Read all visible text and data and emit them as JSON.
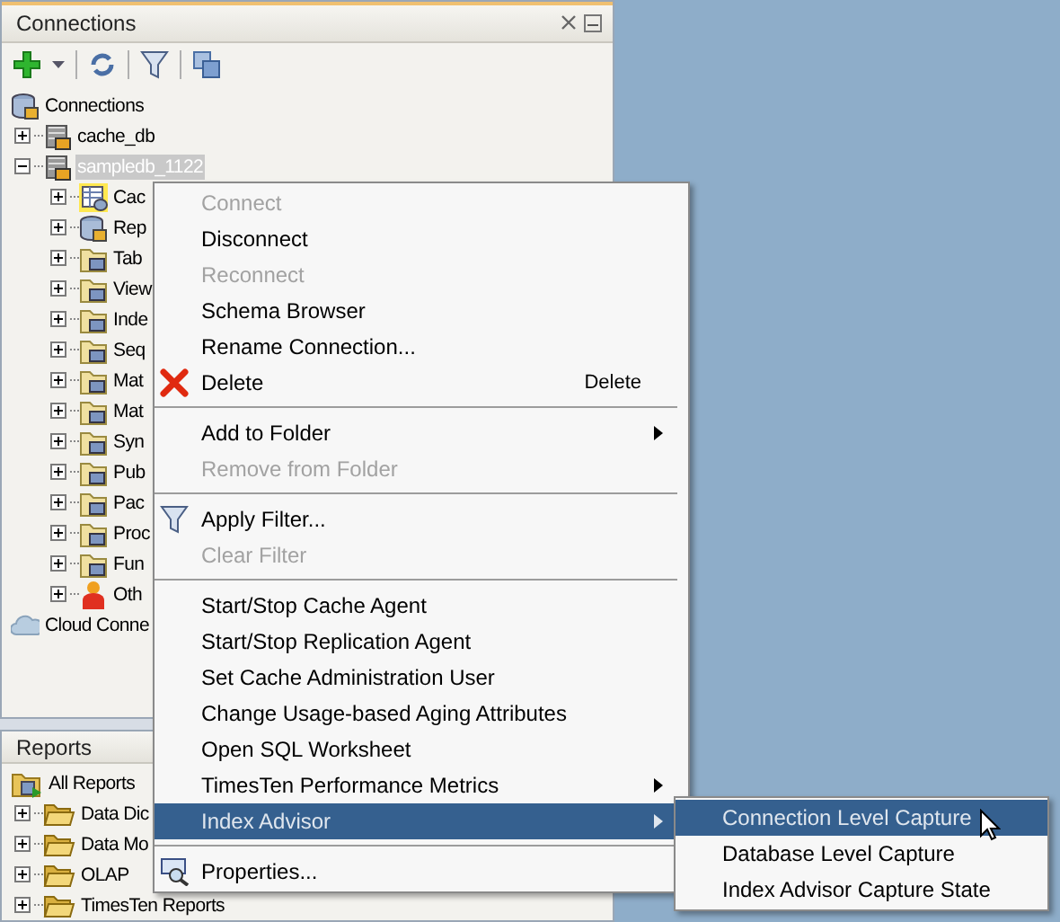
{
  "connections_panel": {
    "title": "Connections",
    "tree": [
      {
        "label": "Connections",
        "kind": "database",
        "children": [
          {
            "label": "cache_db",
            "kind": "connection",
            "expanded": false,
            "selected": false
          },
          {
            "label": "sampledb_1122",
            "kind": "connection",
            "expanded": true,
            "selected": true,
            "children": [
              {
                "label": "Cac",
                "kind": "table",
                "expanded": false
              },
              {
                "label": "Rep",
                "kind": "database",
                "expanded": false
              },
              {
                "label": "Tab",
                "kind": "folder",
                "expanded": false
              },
              {
                "label": "View",
                "kind": "folder",
                "expanded": false
              },
              {
                "label": "Inde",
                "kind": "folder",
                "expanded": false
              },
              {
                "label": "Seq",
                "kind": "folder",
                "expanded": false
              },
              {
                "label": "Mat",
                "kind": "folder",
                "expanded": false
              },
              {
                "label": "Mat",
                "kind": "folder",
                "expanded": false
              },
              {
                "label": "Syn",
                "kind": "folder",
                "expanded": false
              },
              {
                "label": "Pub",
                "kind": "folder",
                "expanded": false
              },
              {
                "label": "Pac",
                "kind": "folder",
                "expanded": false
              },
              {
                "label": "Proc",
                "kind": "folder",
                "expanded": false
              },
              {
                "label": "Fun",
                "kind": "folder",
                "expanded": false
              },
              {
                "label": "Oth",
                "kind": "person",
                "expanded": false
              }
            ]
          }
        ]
      },
      {
        "label": "Cloud Conne",
        "kind": "cloud"
      }
    ]
  },
  "reports_panel": {
    "title": "Reports",
    "tree": [
      {
        "label": "All Reports",
        "kind": "reports",
        "children": [
          {
            "label": "Data Dic",
            "kind": "open-folder",
            "expanded": false
          },
          {
            "label": "Data Mo",
            "kind": "open-folder",
            "expanded": false
          },
          {
            "label": "OLAP",
            "kind": "open-folder",
            "expanded": false
          },
          {
            "label": "TimesTen Reports",
            "kind": "open-folder",
            "expanded": false
          }
        ]
      }
    ]
  },
  "context_menu": [
    {
      "kind": "item",
      "label": "Connect",
      "disabled": true,
      "selected": false
    },
    {
      "kind": "item",
      "label": "Disconnect",
      "disabled": false,
      "selected": false
    },
    {
      "kind": "item",
      "label": "Reconnect",
      "disabled": true,
      "selected": false
    },
    {
      "kind": "item",
      "label": "Schema Browser",
      "disabled": false,
      "selected": false
    },
    {
      "kind": "item",
      "label": "Rename Connection...",
      "disabled": false,
      "selected": false
    },
    {
      "kind": "delete",
      "label": "Delete",
      "shortcut": "Delete",
      "disabled": false,
      "selected": false
    },
    {
      "kind": "separator"
    },
    {
      "kind": "item",
      "label": "Add to Folder",
      "submenu": true,
      "disabled": false,
      "selected": false
    },
    {
      "kind": "item",
      "label": "Remove from Folder",
      "disabled": true,
      "selected": false
    },
    {
      "kind": "separator"
    },
    {
      "kind": "filter",
      "label": "Apply Filter...",
      "disabled": false,
      "selected": false
    },
    {
      "kind": "item",
      "label": "Clear Filter",
      "disabled": true,
      "selected": false
    },
    {
      "kind": "separator"
    },
    {
      "kind": "item",
      "label": "Start/Stop Cache Agent",
      "disabled": false,
      "selected": false
    },
    {
      "kind": "item",
      "label": "Start/Stop Replication Agent",
      "disabled": false,
      "selected": false
    },
    {
      "kind": "item",
      "label": "Set Cache Administration User",
      "disabled": false,
      "selected": false
    },
    {
      "kind": "item",
      "label": "Change Usage-based Aging Attributes",
      "disabled": false,
      "selected": false
    },
    {
      "kind": "item",
      "label": "Open SQL Worksheet",
      "disabled": false,
      "selected": false
    },
    {
      "kind": "item",
      "label": "TimesTen Performance Metrics",
      "submenu": true,
      "disabled": false,
      "selected": false
    },
    {
      "kind": "item",
      "label": "Index Advisor",
      "submenu": true,
      "disabled": false,
      "selected": true
    },
    {
      "kind": "separator"
    },
    {
      "kind": "properties",
      "label": "Properties...",
      "disabled": false,
      "selected": false
    }
  ],
  "submenu": [
    {
      "label": "Connection Level Capture",
      "selected": true
    },
    {
      "label": "Database Level Capture",
      "selected": false
    },
    {
      "label": "Index Advisor Capture State",
      "selected": false
    }
  ]
}
